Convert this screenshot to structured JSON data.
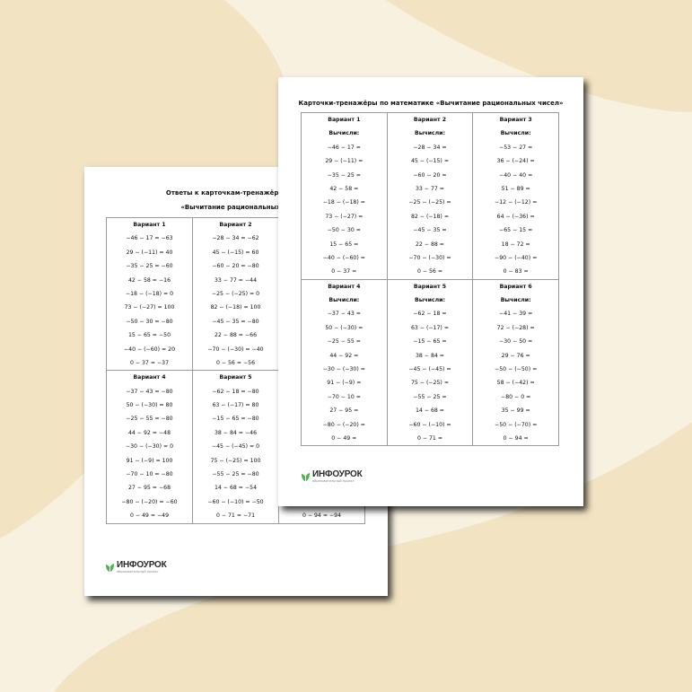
{
  "colors": {
    "background": "#f8f1e0",
    "blob": "#f2e3c2",
    "paper": "#ffffff",
    "logo_green": "#48b64a"
  },
  "back_sheet": {
    "title_line1": "Ответы к карточкам-тренажёрам по м",
    "title_line2": "«Вычитание рациональных чи",
    "rows": [
      [
        {
          "heading": "Вариант 1",
          "lines": [
            "−46 − 17 = −63",
            "29 − (−11) = 40",
            "−35 − 25 = −60",
            "42 − 58 = −16",
            "−18 − (−18) = 0",
            "73 − (−27) = 100",
            "−50 − 30 = −80",
            "15 − 65 = −50",
            "−40 − (−60) = 20",
            "0 − 37 = −37"
          ]
        },
        {
          "heading": "Вариант 2",
          "lines": [
            "−28 − 34 = −62",
            "45 − (−15) = 60",
            "−60 − 20 = −80",
            "33 − 77 = −44",
            "−25 − (−25) = 0",
            "82 − (−18) = 100",
            "−45 − 35 = −80",
            "22 − 88 = −66",
            "−70 − (−30) = −40",
            "0 − 56 = −56"
          ]
        },
        {
          "heading": "",
          "lines": []
        }
      ],
      [
        {
          "heading": "Вариант 4",
          "lines": [
            "−37 − 43 = −80",
            "50 − (−30) = 80",
            "−25 − 55 = −80",
            "44 − 92 = −48",
            "−30 − (−30) = 0",
            "91 − (−9) = 100",
            "−70 − 10 = −80",
            "27 − 95 = −68",
            "−80 − (−20) = −60",
            "0 − 49 = −49"
          ]
        },
        {
          "heading": "Вариант 5",
          "lines": [
            "−62 − 18 = −80",
            "63 − (−17) = 80",
            "−15 − 65 = −80",
            "38 − 84 = −46",
            "−45 − (−45) = 0",
            "75 − (−25) = 100",
            "−55 − 25 = −80",
            "14 − 68 = −54",
            "−60 − (−10) = −50",
            "0 − 71 = −71"
          ]
        },
        {
          "heading": "",
          "lines": [
            "",
            "",
            "",
            "",
            "",
            "",
            "",
            "",
            "",
            "0 − 94 = −94"
          ]
        }
      ]
    ],
    "logo": {
      "name": "ИНФОУРОК",
      "tagline": "образовательный проект",
      "icon": "infourok-leaf-icon"
    }
  },
  "front_sheet": {
    "title": "Карточки-тренажёры по математике «Вычитание рациональных чисел»",
    "rows": [
      [
        {
          "heading": "Вариант 1",
          "task": "Вычисли:",
          "lines": [
            "−46 − 17 =",
            "29 − (−11) =",
            "−35 − 25 =",
            "42 − 58 =",
            "−18 − (−18) =",
            "73 − (−27) =",
            "−50 − 30 =",
            "15 − 65 =",
            "−40 − (−60) =",
            "0 − 37 ="
          ]
        },
        {
          "heading": "Вариант 2",
          "task": "Вычисли:",
          "lines": [
            "−28 − 34 =",
            "45 − (−15) =",
            "−60 − 20 =",
            "33 − 77 =",
            "−25 − (−25) =",
            "82 − (−18) =",
            "−45 − 35 =",
            "22 − 88 =",
            "−70 − (−30) =",
            "0 − 56 ="
          ]
        },
        {
          "heading": "Вариант 3",
          "task": "Вычисли:",
          "lines": [
            "−53 − 27 =",
            "36 − (−24) =",
            "−40 − 40 =",
            "51 − 89 =",
            "−12 − (−12) =",
            "64 − (−36) =",
            "−65 − 15 =",
            "18 − 72 =",
            "−90 − (−40) =",
            "0 − 83 ="
          ]
        }
      ],
      [
        {
          "heading": "Вариант 4",
          "task": "Вычисли:",
          "lines": [
            "−37 − 43 =",
            "50 − (−30) =",
            "−25 − 55 =",
            "44 − 92 =",
            "−30 − (−30) =",
            "91 − (−9) =",
            "−70 − 10 =",
            "27 − 95 =",
            "−80 − (−20) =",
            "0 − 49 ="
          ]
        },
        {
          "heading": "Вариант 5",
          "task": "Вычисли:",
          "lines": [
            "−62 − 18 =",
            "63 − (−17) =",
            "−15 − 65 =",
            "38 − 84 =",
            "−45 − (−45) =",
            "75 − (−25) =",
            "−55 − 25 =",
            "14 − 68 =",
            "−60 − (−10) =",
            "0 − 71 ="
          ]
        },
        {
          "heading": "Вариант 6",
          "task": "Вычисли:",
          "lines": [
            "−41 − 39 =",
            "72 − (−28) =",
            "−30 − 50 =",
            "29 − 76 =",
            "−50 − (−50) =",
            "58 − (−42) =",
            "−80 − 0 =",
            "35 − 99 =",
            "−50 − (−70) =",
            "0 − 94 ="
          ]
        }
      ]
    ],
    "logo": {
      "name": "ИНФОУРОК",
      "tagline": "образовательный проект",
      "icon": "infourok-leaf-icon"
    }
  }
}
